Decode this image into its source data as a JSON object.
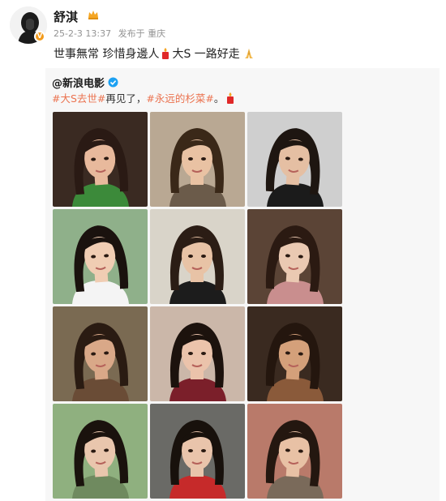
{
  "post": {
    "username": "舒淇",
    "date": "25-2-3 13:37",
    "source": "发布于 重庆",
    "text_part1": "世事無常 珍惜身邊人",
    "text_part2": "大S  一路好走"
  },
  "repost": {
    "author": "@新浪电影",
    "hashtag1": "#大S去世#",
    "text_middle": " 再见了，",
    "hashtag2": "#永远的杉菜#",
    "text_end": " 。"
  },
  "colors": {
    "hashtag": "#eb7350",
    "verified": "#1da1f2",
    "meta": "#939393",
    "repost_bg": "#f7f7f7"
  },
  "icons": {
    "crown": "crown-icon",
    "candle": "candle-icon",
    "pray": "pray-icon",
    "verified": "verified-icon"
  },
  "photos": [
    {
      "bg": "#3a2a22",
      "skin": "#e8b99c",
      "hair": "#2a1a14",
      "cloth": "#3c8a3a"
    },
    {
      "bg": "#b9a893",
      "skin": "#e9c2a3",
      "hair": "#3a2818",
      "cloth": "#6b5b4a"
    },
    {
      "bg": "#cfcfcf",
      "skin": "#e5bfa3",
      "hair": "#1e1611",
      "cloth": "#1b1b1b"
    },
    {
      "bg": "#8fb08a",
      "skin": "#f0cdb3",
      "hair": "#1a120e",
      "cloth": "#f4f4f4"
    },
    {
      "bg": "#d9d4c9",
      "skin": "#e8c3a6",
      "hair": "#2b1d15",
      "cloth": "#1c1c1c"
    },
    {
      "bg": "#5b4436",
      "skin": "#eac9b2",
      "hair": "#2b1a12",
      "cloth": "#c98e8e"
    },
    {
      "bg": "#7a6a52",
      "skin": "#d9a888",
      "hair": "#2a1b12",
      "cloth": "#6a4c36"
    },
    {
      "bg": "#cbb7a9",
      "skin": "#ebc3ab",
      "hair": "#1c120d",
      "cloth": "#7b1f2a"
    },
    {
      "bg": "#3a2a20",
      "skin": "#d4a07a",
      "hair": "#24160e",
      "cloth": "#8a5a3a"
    },
    {
      "bg": "#8fb07f",
      "skin": "#e9c6ad",
      "hair": "#1a120d",
      "cloth": "#6f8a5f"
    },
    {
      "bg": "#6a6a66",
      "skin": "#e9c4ab",
      "hair": "#18110c",
      "cloth": "#c62a2a"
    },
    {
      "bg": "#b97a6a",
      "skin": "#e8c1a5",
      "hair": "#241710",
      "cloth": "#7a6a5a"
    }
  ]
}
